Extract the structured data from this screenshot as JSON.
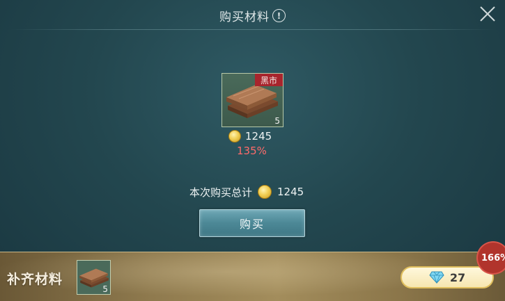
{
  "dialog": {
    "title": "购买材料",
    "info_icon_text": "!"
  },
  "item": {
    "tag": "黑市",
    "count": "5",
    "price": "1245",
    "markup": "135%"
  },
  "total": {
    "label": "本次购买总计",
    "value": "1245"
  },
  "buy_button": {
    "label": "购买"
  },
  "bottom_bar": {
    "label": "补齐材料",
    "item_count": "5",
    "diamond_value": "27",
    "badge": "166%"
  },
  "colors": {
    "accent_red": "#ff6b6b",
    "tag_red": "#a8252d",
    "button_teal": "#4c8896",
    "gold_border": "#e0bf5e"
  }
}
